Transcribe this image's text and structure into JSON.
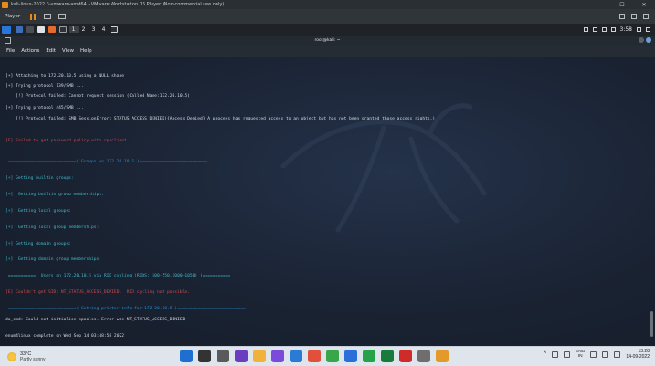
{
  "vmware": {
    "title": "kali-linux-2022.3-vmware-amd64 - VMware Workstation 16 Player (Non-commercial use only)",
    "player_label": "Player",
    "controls": [
      "–",
      "☐",
      "✕"
    ]
  },
  "kali_panel": {
    "workspaces": [
      "1",
      "2",
      "3",
      "4"
    ],
    "time": "3:58"
  },
  "terminal": {
    "window_title": "root@kali: ~",
    "menu": [
      "File",
      "Actions",
      "Edit",
      "View",
      "Help"
    ],
    "lines": [
      {
        "text": "[+] Attaching to 172.20.10.5 using a NULL share",
        "color": "#d7dbe0"
      },
      {
        "text": "[+] Trying protocol 139/SMB ...",
        "color": "#d7dbe0"
      },
      {
        "text": "    [!] Protocol failed: Cannot request session (Called Name:172.20.10.5)",
        "color": "#d7dbe0"
      },
      {
        "text": "[+] Trying protocol 445/SMB ...",
        "color": "#d7dbe0"
      },
      {
        "text": "    [!] Protocol failed: SMB SessionError: STATUS_ACCESS_DENIED({Access Denied} A process has requested access to an object but has not been granted those access rights.)",
        "color": "#d7dbe0"
      },
      {
        "text": "[E] Failed to get password policy with rpcclient",
        "color": "#d24a4a"
      },
      {
        "text": " ===========================( Groups on 172.20.10.5 )===========================",
        "color": "#2b8fd1"
      },
      {
        "text": "[+] Getting builtin groups:",
        "color": "#3fb9c8"
      },
      {
        "text": "[+]  Getting builtin group memberships:",
        "color": "#3fb9c8"
      },
      {
        "text": "[+]  Getting local groups:",
        "color": "#3fb9c8"
      },
      {
        "text": "[+]  Getting local group memberships:",
        "color": "#3fb9c8"
      },
      {
        "text": "[+] Getting domain groups:",
        "color": "#3fb9c8"
      },
      {
        "text": "[+]  Getting domain group memberships:",
        "color": "#3fb9c8"
      },
      {
        "text": " ===========( Users on 172.20.10.5 via RID cycling (RIDS: 500-550,1000-1050) )===========",
        "color": "#3fb9c8"
      },
      {
        "text": "[E] Couldn't get SID: NT_STATUS_ACCESS_DENIED.  RID cycling not possible.",
        "color": "#d24a4a"
      },
      {
        "text": " ===========================( Getting printer info for 172.20.10.5 )===========================",
        "color": "#2b8fd1"
      },
      {
        "text": "do_cmd: Could not initialise spoolss. Error was NT_STATUS_ACCESS_DENIED",
        "color": "#d7dbe0"
      },
      {
        "text": "enum4linux complete on Wed Sep 14 03:48:58 2022",
        "color": "#d7dbe0"
      }
    ]
  },
  "taskbar": {
    "weather_temp": "33°C",
    "weather_condition": "Partly sunny",
    "lang_1": "ENG",
    "lang_2": "IN",
    "time": "13:28",
    "date": "14-09-2022",
    "app_colors": [
      "#1f6fd1",
      "#333333",
      "#5a5a5a",
      "#6a3fbf",
      "#f0b23a",
      "#7a4cd9",
      "#2a7bd6",
      "#e0503a",
      "#3aa64a",
      "#2b6fd8",
      "#25a24a",
      "#1a7a3a",
      "#d02b2b",
      "#6e6e6e",
      "#e39a2a"
    ]
  }
}
